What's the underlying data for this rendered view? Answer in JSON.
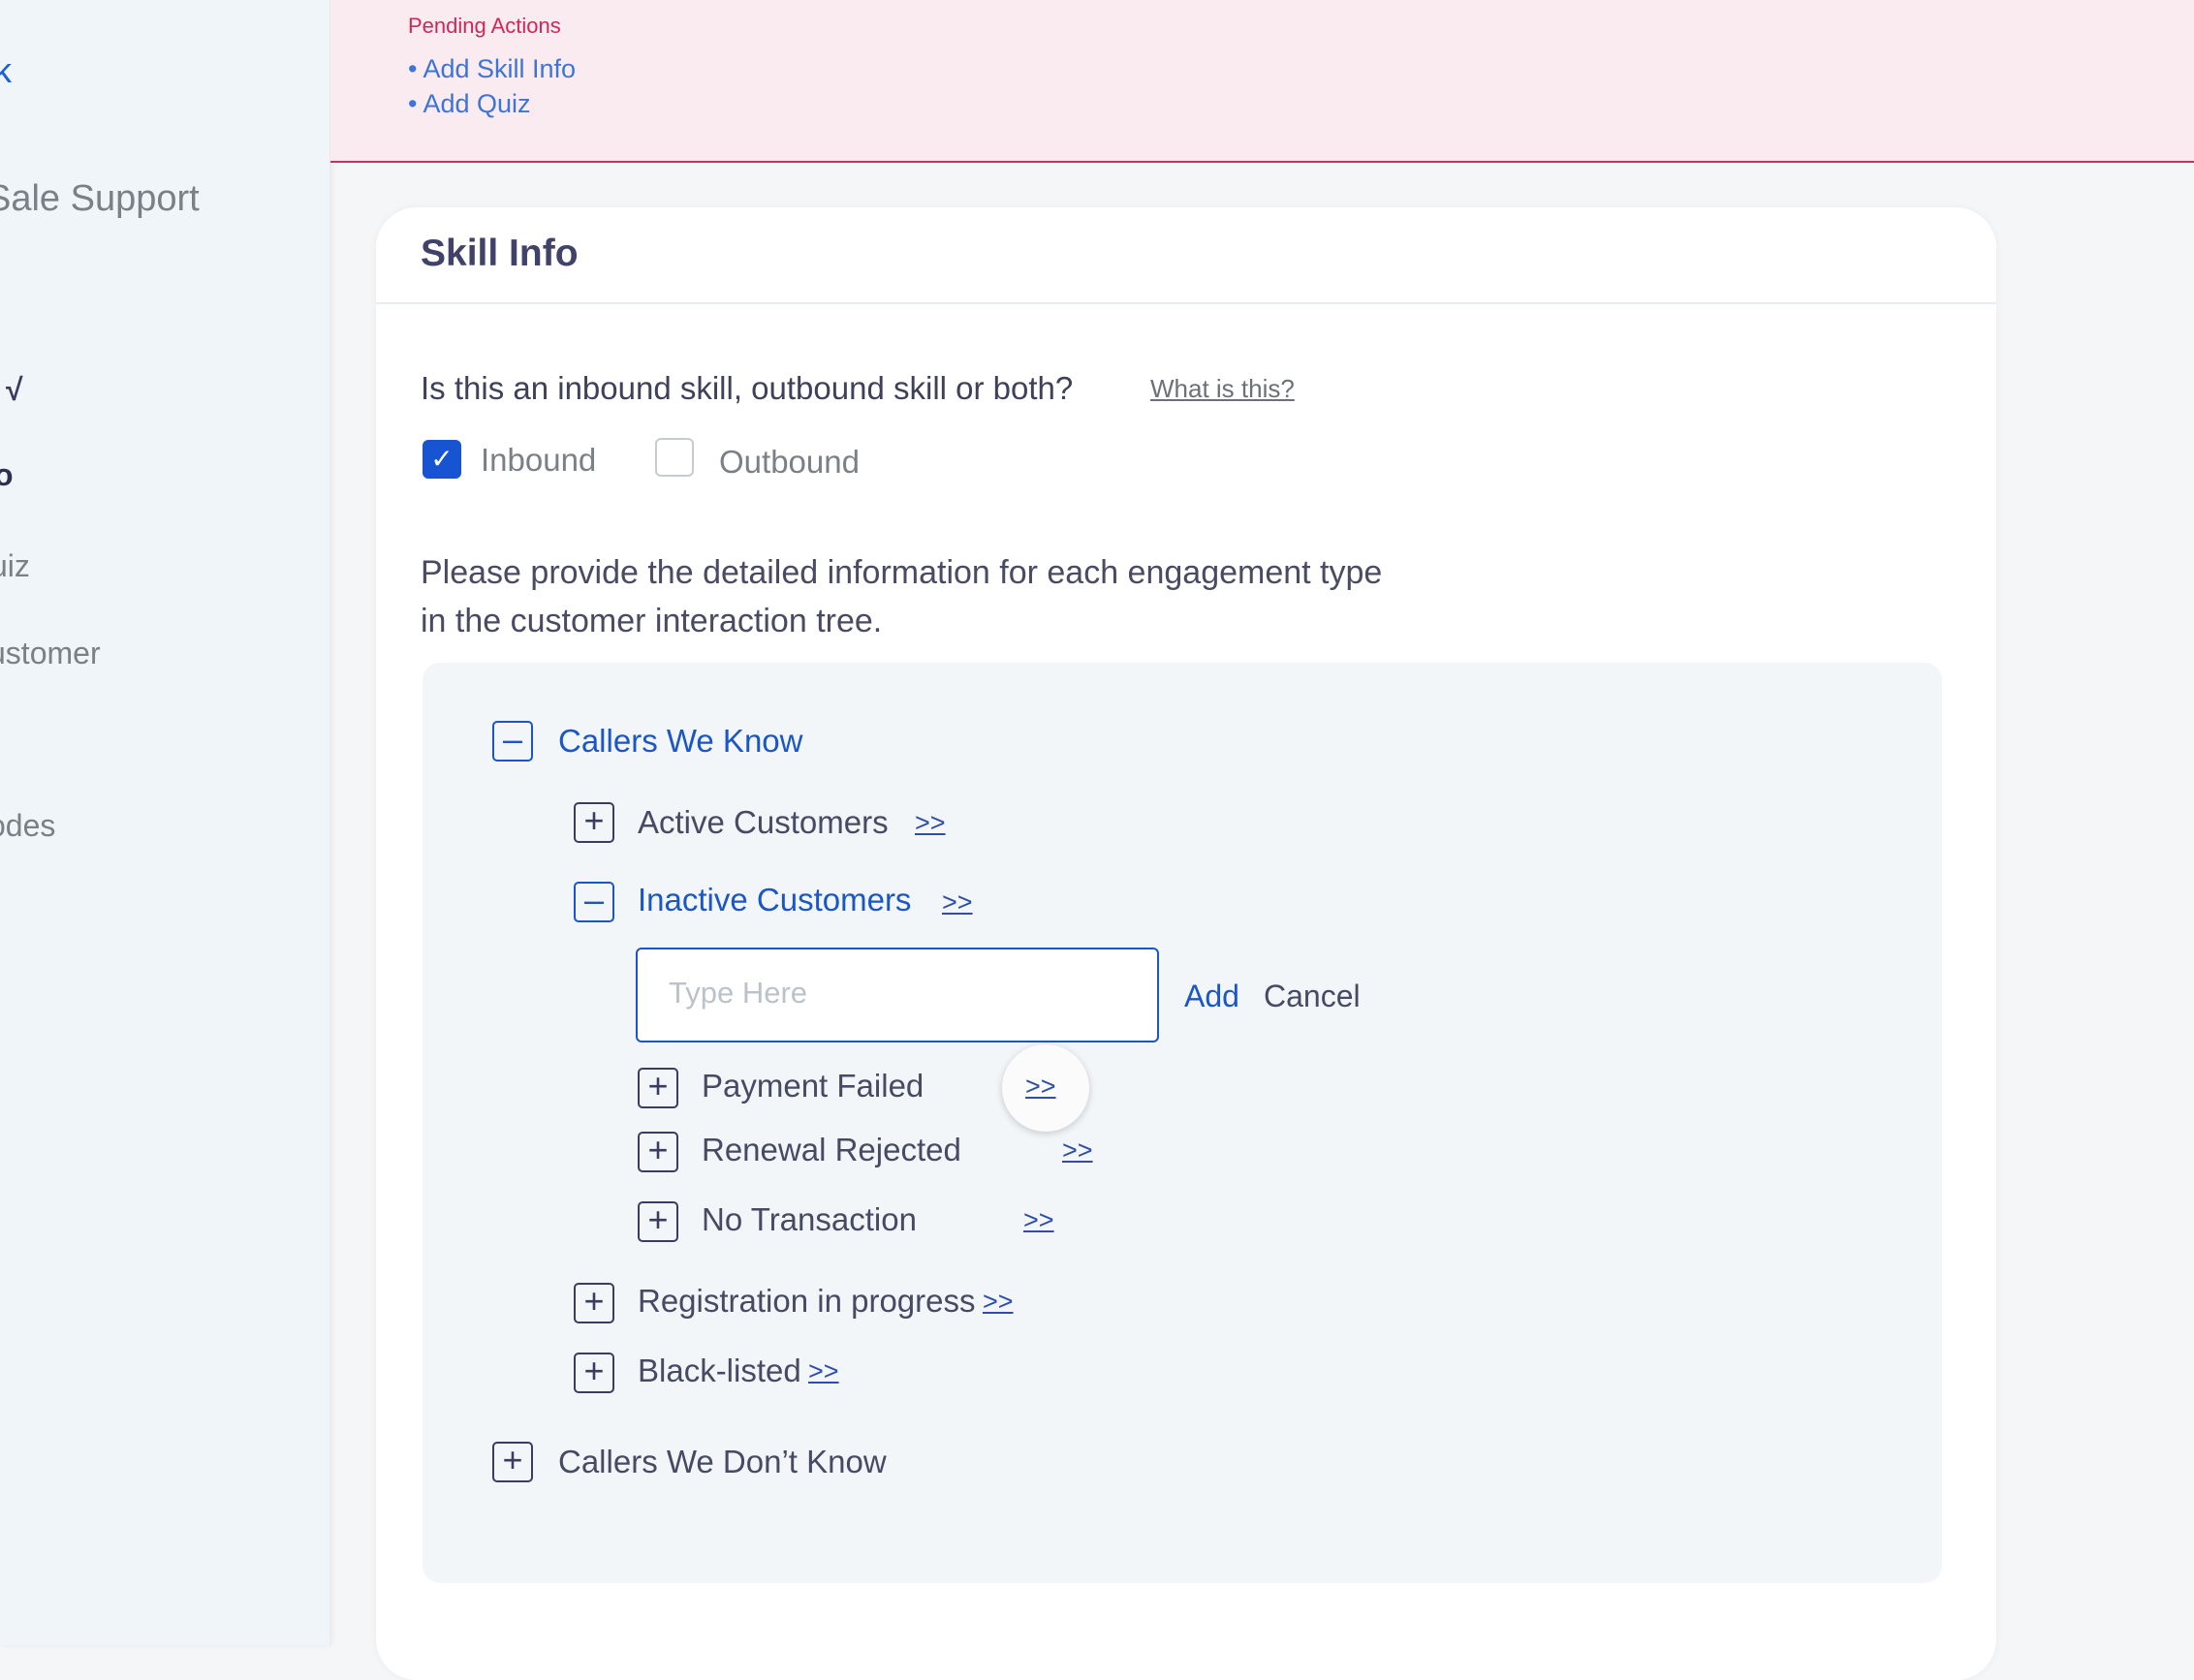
{
  "sidebar": {
    "back_glyph": "k",
    "title": "Sale Support",
    "check_item": "√",
    "info_item": "o",
    "quiz_item": "uiz",
    "customer_item": "ustomer",
    "codes_item": "odes"
  },
  "pending": {
    "title": "Pending Actions",
    "actions": [
      "• Add Skill Info",
      "• Add Quiz"
    ]
  },
  "card": {
    "title": "Skill Info",
    "question": "Is this an inbound skill, outbound skill or both?",
    "what_is_link": "What is this?",
    "inbound": {
      "label": "Inbound",
      "checked": true
    },
    "outbound": {
      "label": "Outbound",
      "checked": false
    },
    "description_line1": "Please provide the detailed information for each engagement type",
    "description_line2": "in the customer interaction tree."
  },
  "tree": {
    "arrow_label": ">>",
    "callers_we_know": "Callers We Know",
    "active_customers": "Active Customers",
    "inactive_customers": "Inactive Customers",
    "input_placeholder": "Type Here",
    "add_label": "Add",
    "cancel_label": "Cancel",
    "payment_failed": "Payment Failed",
    "renewal_rejected": "Renewal Rejected",
    "no_transaction": "No Transaction",
    "registration_in_progress": "Registration in progress",
    "black_listed": "Black-listed",
    "callers_we_dont_know": "Callers We Don’t Know"
  },
  "colors": {
    "accent": "#1b56c9",
    "pending_text": "#d0275a",
    "pending_bg": "#f9ebef"
  }
}
